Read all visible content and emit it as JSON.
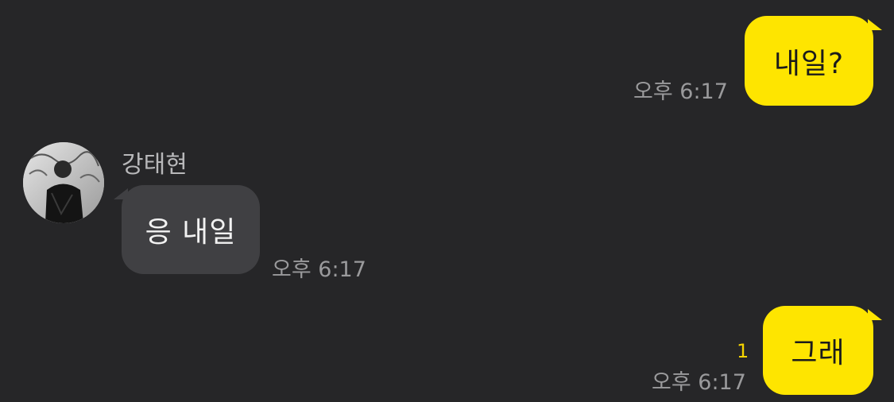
{
  "messages": [
    {
      "side": "mine",
      "text": "내일?",
      "time": "오후 6:17"
    },
    {
      "side": "theirs",
      "sender": "강태현",
      "text": "응 내일",
      "time": "오후 6:17"
    },
    {
      "side": "mine",
      "text": "그래",
      "time": "오후 6:17",
      "unread": "1"
    }
  ],
  "colors": {
    "background": "#262628",
    "my_bubble": "#fee500",
    "their_bubble": "#404043",
    "timestamp": "#9a9a9c",
    "unread_count": "#f5d300"
  },
  "icons": {
    "avatar": "profile-photo"
  }
}
